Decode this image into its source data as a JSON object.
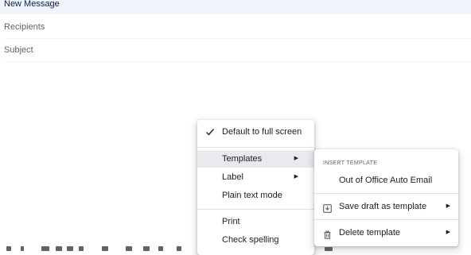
{
  "compose": {
    "title": "New Message",
    "recipients_placeholder": "Recipients",
    "subject_placeholder": "Subject"
  },
  "more_options_menu": {
    "items": [
      {
        "label": "Default to full screen",
        "checked": true
      },
      {
        "label": "Templates",
        "has_submenu": true,
        "highlighted": true
      },
      {
        "label": "Label",
        "has_submenu": true
      },
      {
        "label": "Plain text mode"
      },
      {
        "label": "Print"
      },
      {
        "label": "Check spelling"
      }
    ]
  },
  "templates_submenu": {
    "section_header": "INSERT TEMPLATE",
    "items": [
      {
        "label": "Out of Office Auto Email"
      },
      {
        "label": "Save draft as template",
        "icon": "save-download-icon",
        "has_submenu": true
      },
      {
        "label": "Delete template",
        "icon": "trash-icon",
        "has_submenu": true
      }
    ]
  },
  "colors": {
    "header_bg": "#f2f6fc",
    "title_text": "#041e49",
    "highlight": "#e8eaed"
  }
}
